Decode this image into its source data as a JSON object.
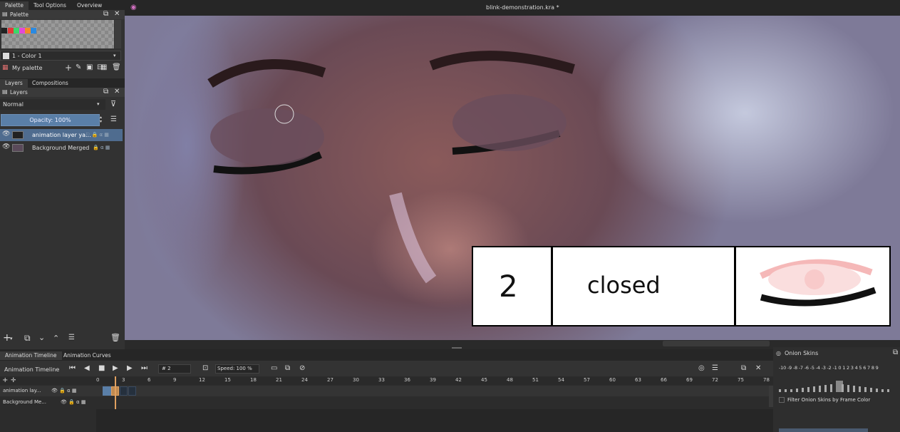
{
  "window": {
    "title": "blink-demonstration.kra *"
  },
  "top_tabs": [
    "Palette",
    "Tool Options",
    "Overview"
  ],
  "palette": {
    "header": "Palette",
    "swatch_colors": [
      "#e23a3a",
      "#3ad86a",
      "#e24ad8",
      "#f08a2a",
      "#2a8ae2"
    ],
    "selected_color": "1 - Color 1",
    "palette_name": "My palette"
  },
  "layers_tabs": [
    "Layers",
    "Compositions"
  ],
  "layers": {
    "header": "Layers",
    "blend_mode": "Normal",
    "opacity": "Opacity: 100%",
    "items": [
      {
        "name": "animation layer ya...",
        "selected": true
      },
      {
        "name": "Background Merged",
        "selected": false
      }
    ]
  },
  "caption_card": {
    "number": "2",
    "label": "closed"
  },
  "timeline": {
    "tabs": [
      "Animation Timeline",
      "Animation Curves"
    ],
    "title": "Animation Timeline",
    "frame": "# 2",
    "speed": "Speed: 100 %",
    "ruler": [
      "0",
      "3",
      "6",
      "9",
      "12",
      "15",
      "18",
      "21",
      "24",
      "27",
      "30",
      "33",
      "36",
      "39",
      "42",
      "45",
      "48",
      "51",
      "54",
      "57",
      "60",
      "63",
      "66",
      "69",
      "72",
      "75",
      "78"
    ],
    "tracks": [
      "animation lay...",
      "Background Me..."
    ]
  },
  "onion": {
    "header": "Onion Skins",
    "scale": [
      "-10",
      "-9",
      "-8",
      "-7",
      "-6",
      "-5",
      "-4",
      "-3",
      "-2",
      "-1",
      "0",
      "1",
      "2",
      "3",
      "4",
      "5",
      "6",
      "7",
      "8",
      "9"
    ],
    "filter_label": "Filter Onion Skins by Frame Color"
  }
}
